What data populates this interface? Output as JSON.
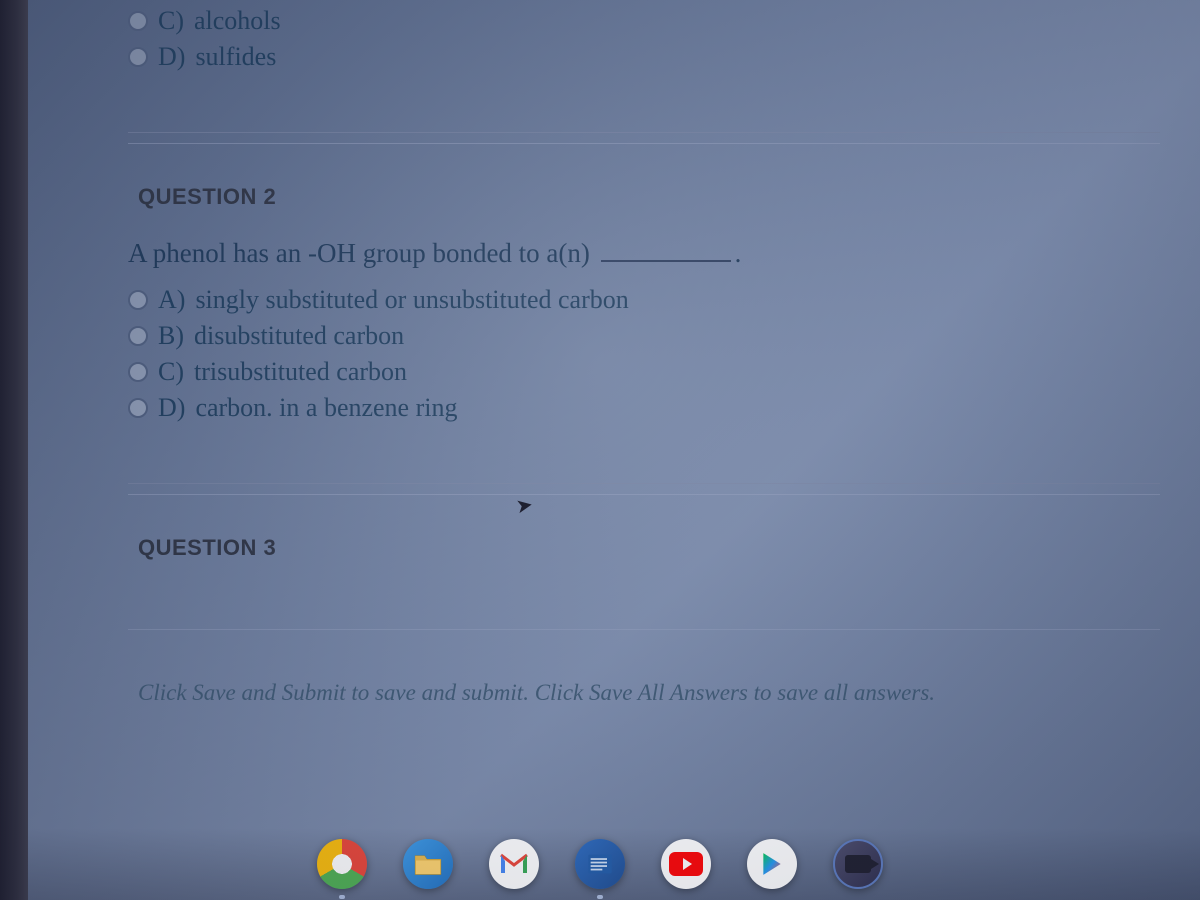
{
  "q1_tail": {
    "options": [
      {
        "letter": "C)",
        "text": "alcohols"
      },
      {
        "letter": "D)",
        "text": "sulfides"
      }
    ]
  },
  "q2": {
    "header": "QUESTION 2",
    "prompt_before": "A phenol has an -OH group bonded to a(n)",
    "prompt_after": ".",
    "options": [
      {
        "letter": "A)",
        "text": "singly substituted or unsubstituted carbon"
      },
      {
        "letter": "B)",
        "text": "disubstituted carbon"
      },
      {
        "letter": "C)",
        "text": "trisubstituted carbon"
      },
      {
        "letter": "D)",
        "text": "carbon. in a benzene ring"
      }
    ]
  },
  "q3": {
    "header": "QUESTION 3"
  },
  "footer": {
    "text": "Click Save and Submit to save and submit. Click Save All Answers to save all answers."
  },
  "taskbar": {
    "icons": [
      {
        "name": "chrome-icon"
      },
      {
        "name": "file-explorer-icon"
      },
      {
        "name": "gmail-icon"
      },
      {
        "name": "word-icon"
      },
      {
        "name": "youtube-icon"
      },
      {
        "name": "play-store-icon"
      },
      {
        "name": "camera-icon"
      }
    ]
  }
}
